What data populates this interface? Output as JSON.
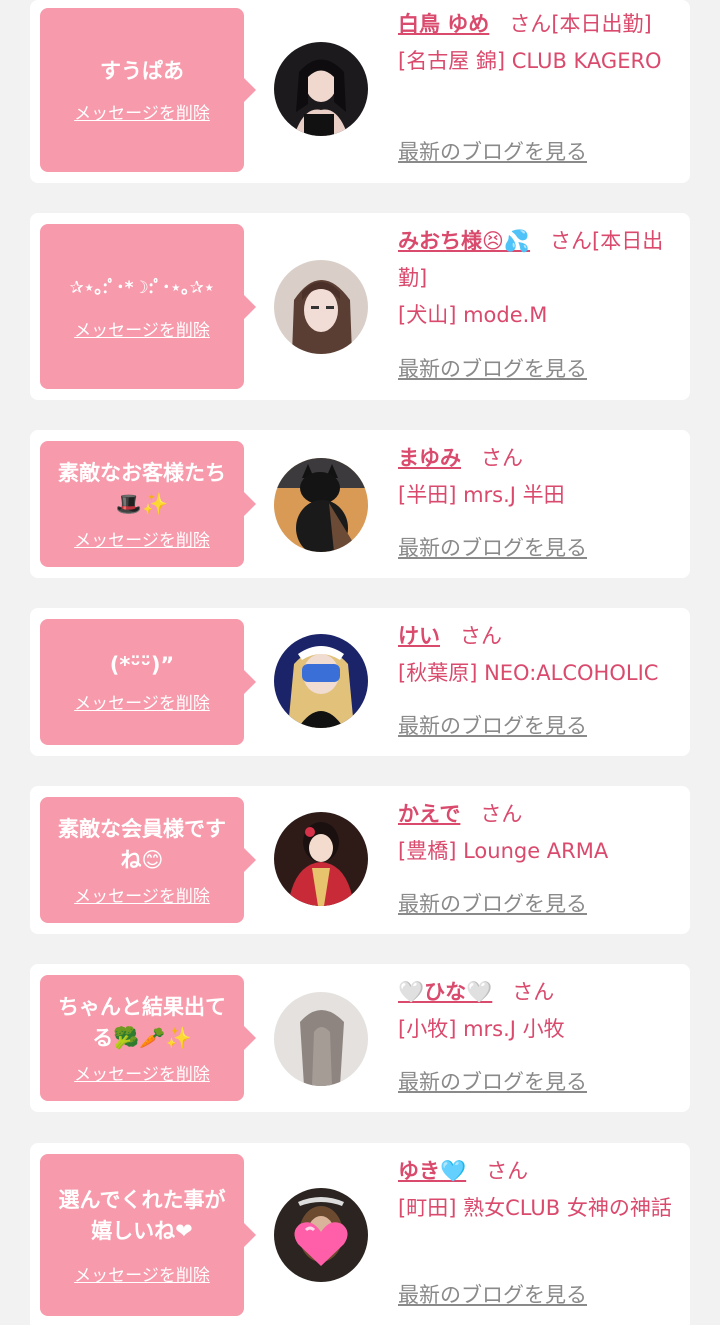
{
  "delete_label": "メッセージを削除",
  "blog_label": "最新のブログを見る",
  "honorific": "さん",
  "colors": {
    "background": "#f2f2f2",
    "card": "#ffffff",
    "bubble": "#f79aab",
    "accent": "#d94a6d",
    "link_gray": "#8a8a8a"
  },
  "entries": [
    {
      "message": "すうぱあ",
      "name": "白鳥 ゆめ",
      "status": "[本日出勤]",
      "area": "[名古屋 錦]",
      "shop": "CLUB KAGERO",
      "avatar": "woman-dark-hair-photo"
    },
    {
      "message": "✰⋆｡:ﾟ･*☽:ﾟ･⋆｡✰⋆",
      "name": "みおち様😣💦",
      "status": "[本日出勤]",
      "area": "[犬山]",
      "shop": "mode.M",
      "avatar": "woman-long-hair-photo"
    },
    {
      "message": "素敵なお客様たち🎩✨",
      "name": "まゆみ",
      "status": "",
      "area": "[半田]",
      "shop": "mrs.J 半田",
      "avatar": "black-cat-photo"
    },
    {
      "message": "(*ᵕ̈ᵕ̈)”",
      "name": "けい",
      "status": "",
      "area": "[秋葉原]",
      "shop": "NEO:ALCOHOLIC",
      "avatar": "masked-maid-photo"
    },
    {
      "message": "素敵な会員様ですね😊",
      "name": "かえで",
      "status": "",
      "area": "[豊橋]",
      "shop": "Lounge ARMA",
      "avatar": "kimono-woman-photo"
    },
    {
      "message": "ちゃんと結果出てる🥦🥕✨",
      "name": "🤍ひな🤍",
      "status": "",
      "area": "[小牧]",
      "shop": "mrs.J 小牧",
      "avatar": "blurred-hair-photo"
    },
    {
      "message": "選んでくれた事が嬉しいね❤",
      "name": "ゆき🩵",
      "status": "",
      "area": "[町田]",
      "shop": "熟女CLUB 女神の神話",
      "avatar": "heart-sticker-photo"
    }
  ]
}
